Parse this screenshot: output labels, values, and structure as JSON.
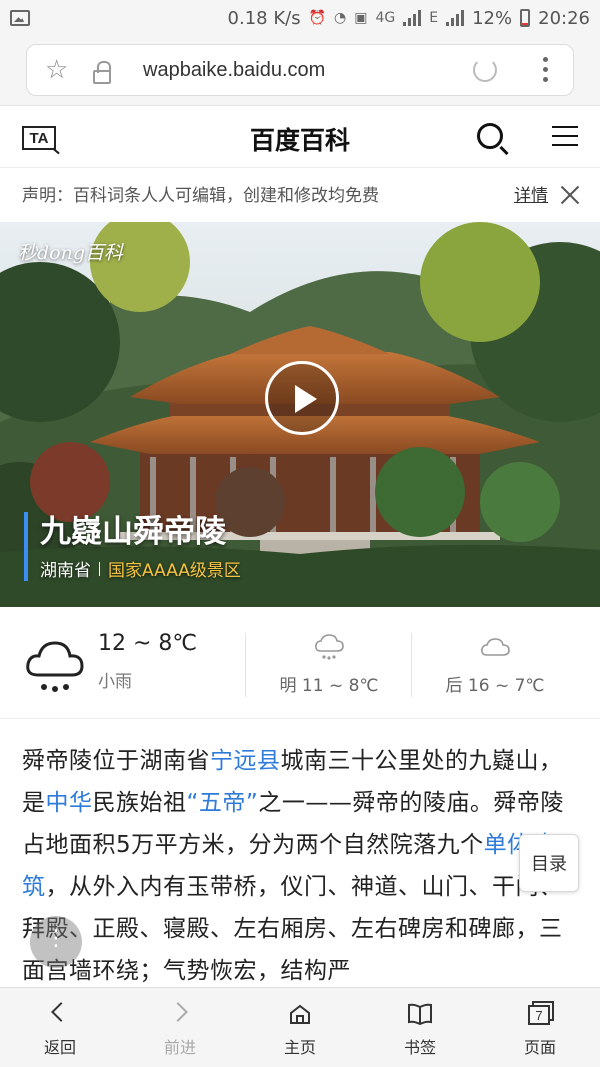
{
  "status_bar": {
    "speed": "0.18 K/s",
    "net": "4G",
    "battery": "12%",
    "time": "20:26"
  },
  "browser": {
    "url": "wapbaike.baidu.com"
  },
  "site": {
    "title": "百度百科",
    "logo_text": "TA"
  },
  "notice": {
    "text": "声明：百科词条人人可编辑，创建和修改均免费",
    "link": "详情"
  },
  "hero": {
    "watermark": "秒dong百科",
    "title": "九嶷山舜帝陵",
    "province": "湖南省",
    "level": "国家AAAA级景区"
  },
  "weather": {
    "today_temp": "12 ~ 8℃",
    "today_desc": "小雨",
    "tomorrow": "明 11 ~ 8℃",
    "after": "后 16 ~ 7℃"
  },
  "article": {
    "segments": [
      {
        "t": "舜帝陵位于湖南省",
        "link": false
      },
      {
        "t": "宁远县",
        "link": true
      },
      {
        "t": "城南三十公里处的九嶷山，是",
        "link": false
      },
      {
        "t": "中华",
        "link": true
      },
      {
        "t": "民族始祖",
        "link": false
      },
      {
        "t": "“五帝”",
        "link": true
      },
      {
        "t": "之一——舜帝的陵庙。舜帝陵占地面积5万平方米，分为两个自然院落九个",
        "link": false
      },
      {
        "t": "单体建筑",
        "link": true
      },
      {
        "t": "，从外入内有玉带桥，仪门、神道、山门、干门、拜殿、正殿、寝殿、左右厢房、左右碑房和碑廊，三面宫墙环绕；气势恢宏，结构严",
        "link": false
      }
    ]
  },
  "toc": {
    "label": "目录"
  },
  "bottom_nav": [
    {
      "label": "返回"
    },
    {
      "label": "前进"
    },
    {
      "label": "主页"
    },
    {
      "label": "书签"
    },
    {
      "label": "页面",
      "badge": "7"
    }
  ],
  "colors": {
    "link": "#2f7bd9",
    "level": "#f6c343",
    "accent_bar": "#3b8ef5"
  }
}
